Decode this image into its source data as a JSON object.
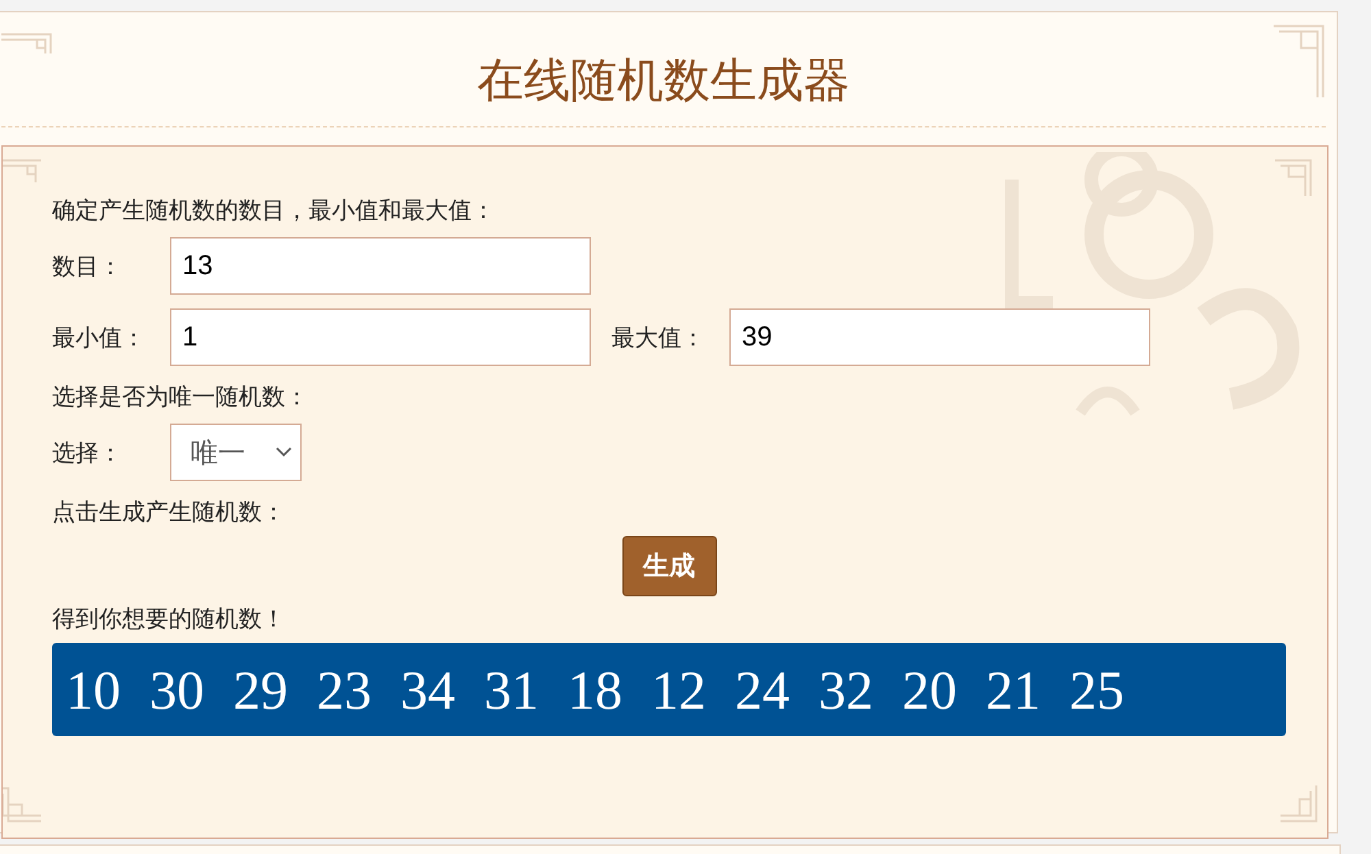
{
  "title": "在线随机数生成器",
  "form": {
    "intro": "确定产生随机数的数目，最小值和最大值：",
    "count": {
      "label": "数目：",
      "value": "13"
    },
    "min": {
      "label": "最小值：",
      "value": "1"
    },
    "max": {
      "label": "最大值：",
      "value": "39"
    },
    "unique_prompt": "选择是否为唯一随机数：",
    "choice": {
      "label": "选择：",
      "value": "唯一"
    },
    "generate_prompt": "点击生成产生随机数：",
    "generate_button": "生成",
    "result_label": "得到你想要的随机数！",
    "results": [
      "10",
      "30",
      "29",
      "23",
      "34",
      "31",
      "18",
      "12",
      "24",
      "32",
      "20",
      "21",
      "25"
    ]
  }
}
